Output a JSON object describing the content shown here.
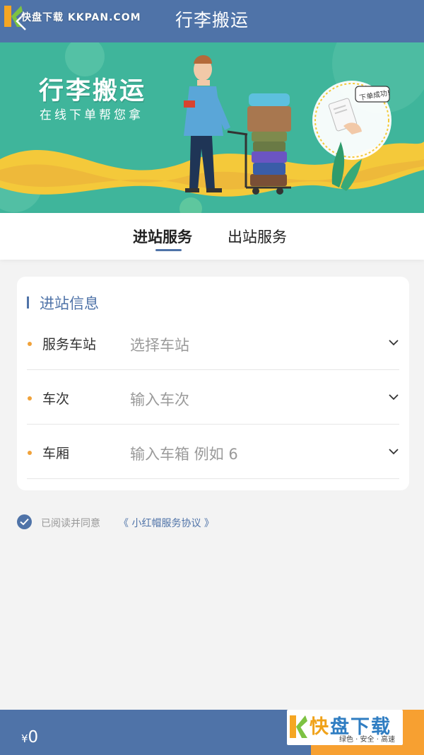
{
  "header": {
    "title": "行李搬运",
    "watermark": "快盘下载 KKPAN.COM"
  },
  "banner": {
    "title": "行李搬运",
    "subtitle": "在线下单帮您拿",
    "bubble_text": "下单成功!"
  },
  "tabs": [
    {
      "label": "进站服务",
      "active": true
    },
    {
      "label": "出站服务",
      "active": false
    }
  ],
  "form": {
    "section_title": "进站信息",
    "rows": [
      {
        "label": "服务车站",
        "placeholder": "选择车站"
      },
      {
        "label": "车次",
        "placeholder": "输入车次"
      },
      {
        "label": "车厢",
        "placeholder": "输入车箱 例如 6"
      }
    ]
  },
  "agreement": {
    "checked": true,
    "text": "已阅读并同意",
    "link": "《 小红帽服务协议 》"
  },
  "footer": {
    "currency": "¥",
    "price": "0"
  },
  "watermark_corner": {
    "big_1": "快",
    "big_2": "盘下载",
    "small": "绿色 · 安全 · 高速"
  },
  "colors": {
    "primary": "#4f73a8",
    "accent": "#f7a031",
    "banner_green": "#3fb59b"
  }
}
